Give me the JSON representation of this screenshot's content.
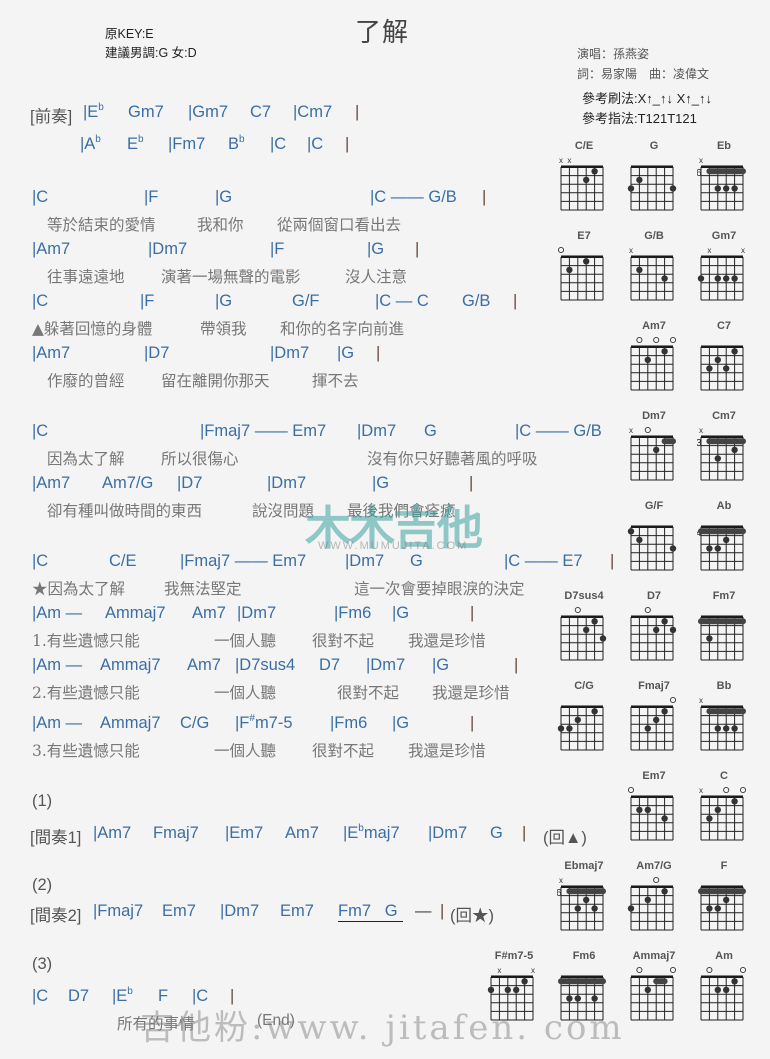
{
  "header": {
    "title": "了解",
    "original_key": "原KEY:E",
    "suggested_key": "建議男調:G 女:D",
    "singer": "演唱：孫燕姿",
    "credits": "詞：易家陽　曲：凌偉文",
    "strum": "參考刷法:X↑_↑↓ X↑_↑↓",
    "finger": "參考指法:T121T121"
  },
  "sheet": {
    "intro_label": "[前奏]",
    "intro_1": [
      "|E",
      "b",
      "Gm7",
      "|Gm7",
      "C7",
      "|Cm7",
      "|"
    ],
    "intro_2": [
      "|A",
      "b",
      "E",
      "b",
      "|Fm7",
      "B",
      "b",
      "|C",
      "|C",
      "|"
    ],
    "v1_chords": [
      "|C",
      "|F",
      "|G",
      "|C —— G/B",
      "|"
    ],
    "v1_lyric": [
      "等於結束的愛情",
      "我和你",
      "從兩個窗口看出去"
    ],
    "v2_chords": [
      "|Am7",
      "|Dm7",
      "|F",
      "|G",
      "|"
    ],
    "v2_lyric": [
      "往事遠遠地",
      "演著一場無聲的電影",
      "沒人注意"
    ],
    "v3_chords": [
      "|C",
      "|F",
      "|G",
      "G/F",
      "|C — C",
      "G/B",
      "|"
    ],
    "v3_lyric": [
      "▲躲著回憶的身體",
      "帶領我",
      "和你的名字向前進"
    ],
    "v4_chords": [
      "|Am7",
      "|D7",
      "|Dm7",
      "|G",
      "|"
    ],
    "v4_lyric": [
      "作廢的曾經",
      "留在離開你那天",
      "揮不去"
    ],
    "c1_chords": [
      "|C",
      "|Fmaj7 —— Em7",
      "|Dm7",
      "G",
      "|C —— G/B",
      "|"
    ],
    "c1_lyric": [
      "因為太了解",
      "所以很傷心",
      "沒有你只好聽著風的呼吸"
    ],
    "c2_chords": [
      "|Am7",
      "Am7/G",
      "|D7",
      "|Dm7",
      "|G",
      "|"
    ],
    "c2_lyric": [
      "卻有種叫做時間的東西",
      "說沒問題",
      "最後我們會痊癒"
    ],
    "c3_chords": [
      "|C",
      "C/E",
      "|Fmaj7 —— Em7",
      "|Dm7",
      "G",
      "|C —— E7",
      "|"
    ],
    "c3_lyric": [
      "★因為太了解",
      "我無法堅定",
      "這一次會要掉眼淚的決定"
    ],
    "c4_chords": [
      "|Am —",
      "Ammaj7",
      "Am7",
      "|Dm7",
      "|Fm6",
      "|G",
      "|"
    ],
    "c4_lyric": [
      "1.有些遺憾只能",
      "一個人聽",
      "很對不起",
      "我還是珍惜"
    ],
    "c5_chords": [
      "|Am —",
      "Ammaj7",
      "Am7",
      "|D7sus4",
      "D7",
      "|Dm7",
      "|G",
      "|"
    ],
    "c5_lyric": [
      "2.有些遺憾只能",
      "一個人聽",
      "很對不起",
      "我還是珍惜"
    ],
    "c6_chords": [
      "|Am —",
      "Ammaj7",
      "C/G",
      "|F",
      "#",
      "m7-5",
      "|Fm6",
      "|G",
      "|"
    ],
    "c6_lyric": [
      "3.有些遺憾只能",
      "一個人聽",
      "很對不起",
      "我還是珍惜"
    ],
    "ending1_label": "(1)",
    "inter1_label": "[間奏1]",
    "inter1": [
      "|Am7",
      "Fmaj7",
      "|Em7",
      "Am7",
      "|E",
      "b",
      "maj7",
      "|Dm7",
      "G",
      "|",
      "(回▲)"
    ],
    "ending2_label": "(2)",
    "inter2_label": "[間奏2]",
    "inter2": [
      "|Fmaj7",
      "Em7",
      "|Dm7",
      "Em7",
      "Fm7",
      "G",
      "—",
      "|",
      "(回★)"
    ],
    "ending3_label": "(3)",
    "outro": [
      "|C",
      "D7",
      "|E",
      "b",
      "F",
      "|C",
      "|"
    ],
    "outro_lyric": [
      "所有的事情",
      "(End)"
    ]
  },
  "chord_diagrams": [
    {
      "name": "C/E",
      "base": "",
      "marks": [
        "x",
        "x",
        "",
        "",
        "",
        ""
      ],
      "dots": [
        [
          3,
          2
        ],
        [
          4,
          1
        ]
      ],
      "barre": null
    },
    {
      "name": "G",
      "base": "",
      "marks": [
        "",
        "",
        "",
        "",
        "",
        ""
      ],
      "dots": [
        [
          0,
          3
        ],
        [
          1,
          2
        ],
        [
          5,
          3
        ]
      ],
      "barre": null
    },
    {
      "name": "Eb",
      "base": "6",
      "marks": [
        "x",
        "",
        "",
        "",
        "",
        ""
      ],
      "dots": [
        [
          2,
          3
        ],
        [
          3,
          3
        ],
        [
          4,
          3
        ]
      ],
      "barre": [
        1,
        5,
        1
      ]
    },
    {
      "name": "E7",
      "base": "",
      "marks": [
        "o",
        "",
        "",
        "",
        "",
        ""
      ],
      "dots": [
        [
          1,
          2
        ],
        [
          3,
          1
        ]
      ],
      "barre": null
    },
    {
      "name": "G/B",
      "base": "",
      "marks": [
        "x",
        "",
        "",
        "",
        "",
        ""
      ],
      "dots": [
        [
          1,
          2
        ],
        [
          4,
          3
        ]
      ],
      "barre": null
    },
    {
      "name": "Gm7",
      "base": "",
      "marks": [
        "",
        "x",
        "",
        "",
        "",
        "x"
      ],
      "dots": [
        [
          0,
          3
        ],
        [
          2,
          3
        ],
        [
          3,
          3
        ],
        [
          4,
          3
        ]
      ],
      "barre": null
    },
    {
      "name": "Am7",
      "base": "",
      "marks": [
        "",
        "o",
        "",
        "o",
        "",
        "o"
      ],
      "dots": [
        [
          2,
          2
        ],
        [
          4,
          1
        ]
      ],
      "barre": null
    },
    {
      "name": "C7",
      "base": "",
      "marks": [
        "",
        "",
        "",
        "",
        "",
        ""
      ],
      "dots": [
        [
          1,
          3
        ],
        [
          2,
          2
        ],
        [
          3,
          3
        ],
        [
          4,
          1
        ]
      ],
      "barre": null
    },
    {
      "name": "Dm7",
      "base": "",
      "marks": [
        "x",
        "",
        "o",
        "",
        "",
        ""
      ],
      "dots": [
        [
          3,
          2
        ]
      ],
      "barre": [
        4,
        5,
        1
      ]
    },
    {
      "name": "Cm7",
      "base": "3",
      "marks": [
        "x",
        "",
        "",
        "",
        "",
        ""
      ],
      "dots": [
        [
          2,
          3
        ],
        [
          4,
          2
        ]
      ],
      "barre": [
        1,
        5,
        1
      ]
    },
    {
      "name": "G/F",
      "base": "",
      "marks": [
        "",
        "",
        "",
        "",
        "",
        ""
      ],
      "dots": [
        [
          0,
          1
        ],
        [
          1,
          2
        ],
        [
          5,
          3
        ]
      ],
      "barre": null
    },
    {
      "name": "Ab",
      "base": "4",
      "marks": [
        "",
        "",
        "",
        "",
        "",
        ""
      ],
      "dots": [
        [
          1,
          3
        ],
        [
          2,
          3
        ],
        [
          3,
          2
        ]
      ],
      "barre": [
        0,
        5,
        1
      ]
    },
    {
      "name": "D7sus4",
      "base": "",
      "marks": [
        "",
        "",
        "o",
        "",
        "",
        ""
      ],
      "dots": [
        [
          3,
          2
        ],
        [
          4,
          1
        ],
        [
          5,
          3
        ]
      ],
      "barre": null
    },
    {
      "name": "D7",
      "base": "",
      "marks": [
        "",
        "",
        "o",
        "",
        "",
        ""
      ],
      "dots": [
        [
          3,
          2
        ],
        [
          4,
          1
        ],
        [
          5,
          2
        ]
      ],
      "barre": null
    },
    {
      "name": "Fm7",
      "base": "",
      "marks": [
        "",
        "",
        "",
        "",
        "",
        ""
      ],
      "dots": [
        [
          1,
          3
        ]
      ],
      "barre": [
        0,
        5,
        1
      ]
    },
    {
      "name": "C/G",
      "base": "",
      "marks": [
        "",
        "",
        "",
        "",
        "",
        ""
      ],
      "dots": [
        [
          0,
          3
        ],
        [
          1,
          3
        ],
        [
          2,
          2
        ],
        [
          4,
          1
        ]
      ],
      "barre": null
    },
    {
      "name": "Fmaj7",
      "base": "",
      "marks": [
        "",
        "",
        "",
        "",
        "",
        "o"
      ],
      "dots": [
        [
          2,
          3
        ],
        [
          3,
          2
        ],
        [
          4,
          1
        ]
      ],
      "barre": null
    },
    {
      "name": "Bb",
      "base": "",
      "marks": [
        "x",
        "",
        "",
        "",
        "",
        ""
      ],
      "dots": [
        [
          2,
          3
        ],
        [
          3,
          3
        ],
        [
          4,
          3
        ]
      ],
      "barre": [
        1,
        5,
        1
      ]
    },
    {
      "name": "Em7",
      "base": "",
      "marks": [
        "o",
        "",
        "",
        "",
        "",
        ""
      ],
      "dots": [
        [
          1,
          2
        ],
        [
          2,
          2
        ],
        [
          4,
          3
        ]
      ],
      "barre": null
    },
    {
      "name": "C",
      "base": "",
      "marks": [
        "x",
        "",
        "",
        "o",
        "",
        "o"
      ],
      "dots": [
        [
          1,
          3
        ],
        [
          2,
          2
        ],
        [
          4,
          1
        ]
      ],
      "barre": null
    },
    {
      "name": "Ebmaj7",
      "base": "6",
      "marks": [
        "x",
        "",
        "",
        "",
        "",
        ""
      ],
      "dots": [
        [
          2,
          3
        ],
        [
          3,
          2
        ],
        [
          4,
          3
        ]
      ],
      "barre": [
        1,
        5,
        1
      ]
    },
    {
      "name": "Am7/G",
      "base": "",
      "marks": [
        "",
        "",
        "",
        "o",
        "",
        ""
      ],
      "dots": [
        [
          0,
          3
        ],
        [
          2,
          2
        ],
        [
          4,
          1
        ]
      ],
      "barre": null
    },
    {
      "name": "F",
      "base": "",
      "marks": [
        "",
        "",
        "",
        "",
        "",
        ""
      ],
      "dots": [
        [
          1,
          3
        ],
        [
          2,
          3
        ],
        [
          3,
          2
        ]
      ],
      "barre": [
        0,
        5,
        1
      ]
    },
    {
      "name": "F#m7-5",
      "base": "",
      "marks": [
        "",
        "x",
        "",
        "",
        "",
        "x"
      ],
      "dots": [
        [
          0,
          2
        ],
        [
          2,
          2
        ],
        [
          3,
          2
        ],
        [
          4,
          1
        ]
      ],
      "barre": null
    },
    {
      "name": "Fm6",
      "base": "",
      "marks": [
        "",
        "",
        "",
        "",
        "",
        ""
      ],
      "dots": [
        [
          1,
          3
        ],
        [
          2,
          3
        ],
        [
          4,
          3
        ]
      ],
      "barre": [
        0,
        5,
        1
      ]
    },
    {
      "name": "Ammaj7",
      "base": "",
      "marks": [
        "",
        "o",
        "",
        "",
        "",
        "o"
      ],
      "dots": [
        [
          2,
          2
        ]
      ],
      "barre": [
        3,
        4,
        1
      ]
    },
    {
      "name": "Am",
      "base": "",
      "marks": [
        "",
        "o",
        "",
        "",
        "",
        "o"
      ],
      "dots": [
        [
          2,
          2
        ],
        [
          3,
          2
        ],
        [
          4,
          1
        ]
      ],
      "barre": null
    }
  ],
  "watermarks": {
    "logo": "木木吉他",
    "logo_url_text": "WWW.MUMUJITA.COM",
    "footer": "吉他粉:www. jitafen. com"
  }
}
